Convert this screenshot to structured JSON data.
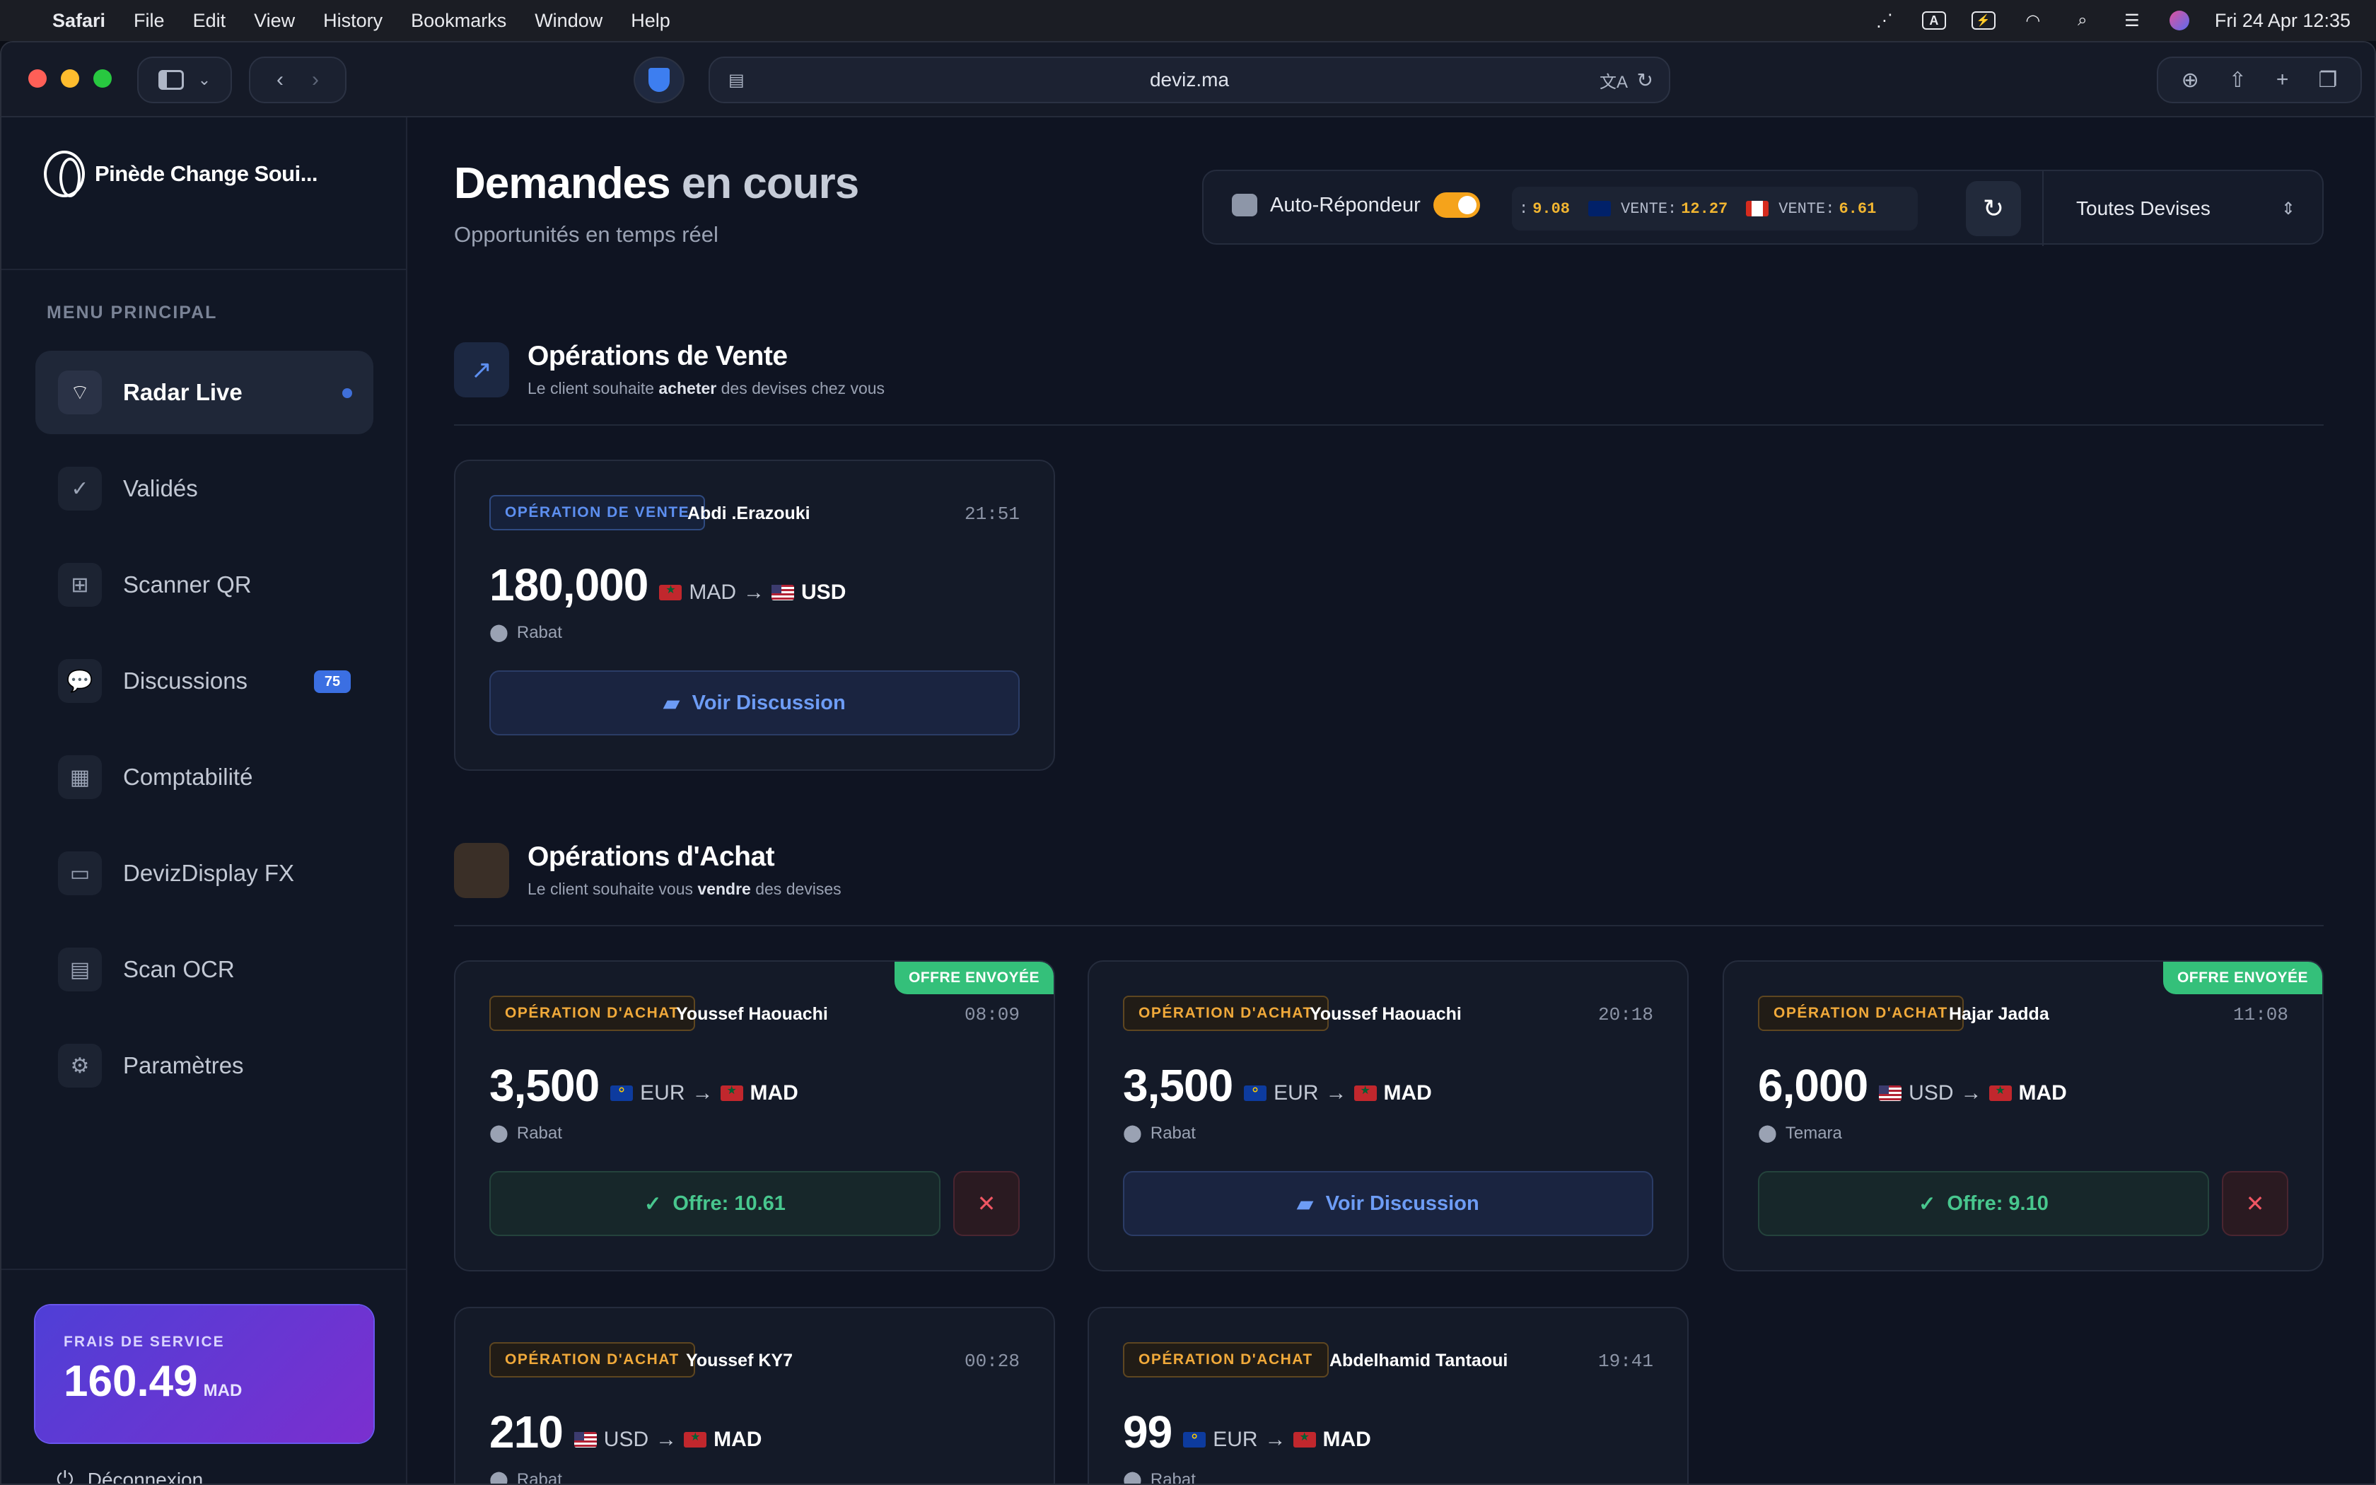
{
  "menubar": {
    "app": "Safari",
    "items": [
      "File",
      "Edit",
      "View",
      "History",
      "Bookmarks",
      "Window",
      "Help"
    ],
    "datetime": "Fri 24 Apr  12:35"
  },
  "browser": {
    "url": "deviz.ma"
  },
  "sidebar": {
    "brand": "Pinède Change Soui...",
    "menu_label": "MENU PRINCIPAL",
    "items": [
      {
        "label": "Radar Live",
        "icon": "radar-icon"
      },
      {
        "label": "Validés",
        "icon": "check-icon"
      },
      {
        "label": "Scanner QR",
        "icon": "qr-icon"
      },
      {
        "label": "Discussions",
        "icon": "chat-icon",
        "badge": "75"
      },
      {
        "label": "Comptabilité",
        "icon": "calculator-icon"
      },
      {
        "label": "DevizDisplay FX",
        "icon": "monitor-icon"
      },
      {
        "label": "Scan OCR",
        "icon": "id-card-icon"
      },
      {
        "label": "Paramètres",
        "icon": "gear-icon"
      }
    ],
    "fees": {
      "label": "FRAIS DE SERVICE",
      "value": "160.49",
      "unit": "MAD"
    },
    "logout": "Déconnexion"
  },
  "header": {
    "title_main": "Demandes",
    "title_accent": "en cours",
    "subtitle": "Opportunités en temps réel",
    "auto_responder": "Auto-Répondeur",
    "auto_responder_on": true,
    "ticker": [
      {
        "label": ":",
        "value": "9.08"
      },
      {
        "label": "VENTE:",
        "value": "12.27",
        "flag": "gb"
      },
      {
        "label": "VENTE:",
        "value": "6.61",
        "flag": "ca"
      }
    ],
    "currency_filter": "Toutes Devises"
  },
  "sales": {
    "title": "Opérations de Vente",
    "sub_pre": "Le client souhaite",
    "sub_bold": "acheter",
    "sub_post": "des devises chez vous",
    "cards": [
      {
        "tag": "OPÉRATION DE VENTE",
        "client": "Abdi .Erazouki",
        "time": "21:51",
        "amount": "180,000",
        "from": "MAD",
        "to": "USD",
        "location": "Rabat",
        "action": "Voir Discussion"
      }
    ]
  },
  "purchases": {
    "title": "Opérations d'Achat",
    "sub_pre": "Le client souhaite vous",
    "sub_bold": "vendre",
    "sub_post": "des devises",
    "cards": [
      {
        "tag": "OPÉRATION D'ACHAT",
        "client": "Youssef Haouachi",
        "time": "08:09",
        "amount": "3,500",
        "from": "EUR",
        "to": "MAD",
        "location": "Rabat",
        "offer": "Offre: 10.61",
        "sent": "OFFRE ENVOYÉE"
      },
      {
        "tag": "OPÉRATION D'ACHAT",
        "client": "Youssef Haouachi",
        "time": "20:18",
        "amount": "3,500",
        "from": "EUR",
        "to": "MAD",
        "location": "Rabat",
        "action": "Voir Discussion"
      },
      {
        "tag": "OPÉRATION D'ACHAT",
        "client": "Hajar Jadda",
        "time": "11:08",
        "amount": "6,000",
        "from": "USD",
        "to": "MAD",
        "location": "Temara",
        "offer": "Offre: 9.10",
        "sent": "OFFRE ENVOYÉE"
      },
      {
        "tag": "OPÉRATION D'ACHAT",
        "client": "Youssef KY7",
        "time": "00:28",
        "amount": "210",
        "from": "USD",
        "to": "MAD",
        "location": "Rabat"
      },
      {
        "tag": "OPÉRATION D'ACHAT",
        "client": "Abdelhamid Tantaoui",
        "time": "19:41",
        "amount": "99",
        "from": "EUR",
        "to": "MAD",
        "location": "Rabat"
      }
    ]
  }
}
